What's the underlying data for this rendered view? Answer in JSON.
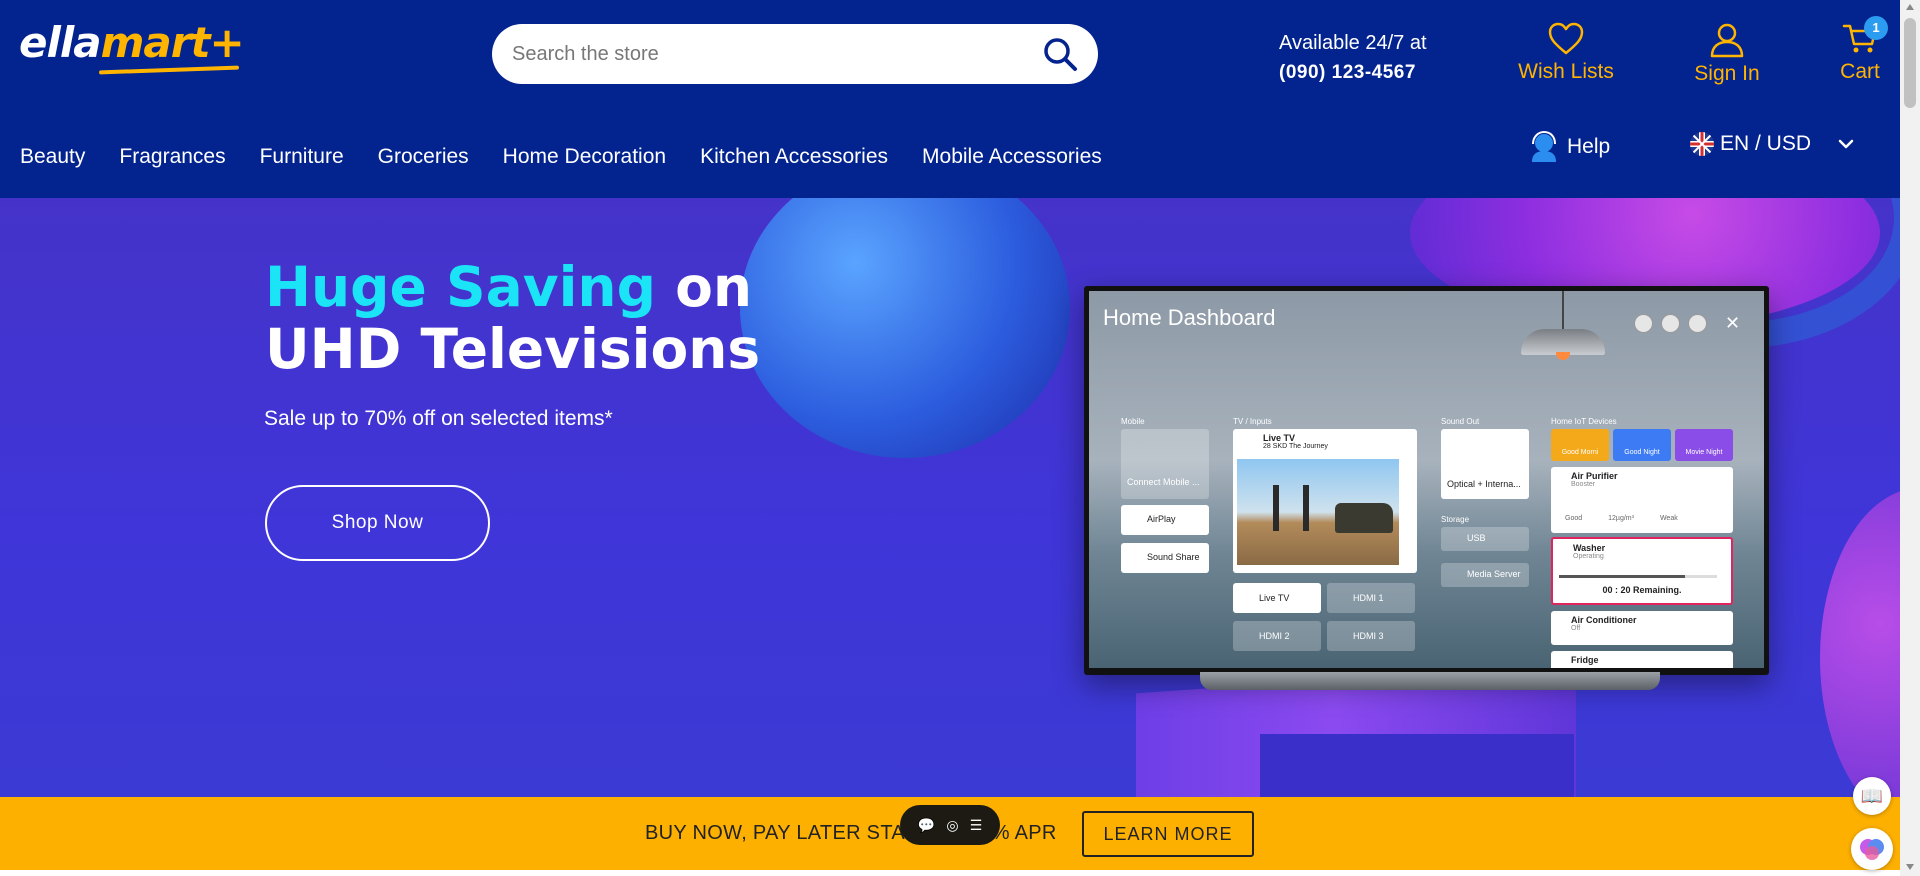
{
  "brand": {
    "logo_part1": "ella",
    "logo_part2": "mart+"
  },
  "search": {
    "placeholder": "Search the store"
  },
  "contact": {
    "label": "Available 24/7 at",
    "phone": "(090) 123-4567"
  },
  "header_actions": {
    "wishlist_label": "Wish Lists",
    "signin_label": "Sign In",
    "cart_label": "Cart",
    "cart_count": "1"
  },
  "nav": {
    "items": [
      {
        "label": "Beauty"
      },
      {
        "label": "Fragrances"
      },
      {
        "label": "Furniture"
      },
      {
        "label": "Groceries"
      },
      {
        "label": "Home Decoration"
      },
      {
        "label": "Kitchen Accessories"
      },
      {
        "label": "Mobile Accessories"
      }
    ],
    "help_label": "Help",
    "locale_label": "EN / USD"
  },
  "hero": {
    "title_highlight": "Huge Saving",
    "title_rest1": " on",
    "title_line2": "UHD Televisions",
    "subtitle": "Sale up to 70% off on selected items*",
    "cta_label": "Shop Now"
  },
  "tv_ui": {
    "title": "Home Dashboard",
    "sections": {
      "mobile": "Mobile",
      "tv_inputs": "TV / Inputs",
      "sound_out": "Sound Out",
      "storage": "Storage",
      "home_iot": "Home IoT Devices"
    },
    "mobile_cards": [
      "Connect Mobile ...",
      "AirPlay",
      "Sound Share"
    ],
    "live_tv": {
      "title": "Live TV",
      "channel": "28 SKD The Journey"
    },
    "inputs": [
      "Live TV",
      "HDMI 1",
      "HDMI 2",
      "HDMI 3"
    ],
    "sound_out_label": "Optical + Interna...",
    "storage_items": [
      "USB",
      "Media Server"
    ],
    "iot_tiles": [
      "Good Morni",
      "Good Night",
      "Movie Night"
    ],
    "devices": {
      "air_purifier": {
        "name": "Air Purifier",
        "status": "Booster",
        "stats": [
          "Good",
          "12µg/m³",
          "Weak"
        ]
      },
      "washer": {
        "name": "Washer",
        "status": "Operating",
        "remaining": "00 : 20 Remaining.",
        "progress": 0.8
      },
      "air_conditioner": {
        "name": "Air Conditioner",
        "status": "Off"
      },
      "fridge": {
        "name": "Fridge"
      }
    }
  },
  "promo": {
    "text": "BUY NOW, PAY LATER STAR",
    "text_tail": "% APR",
    "cta_label": "LEARN MORE"
  },
  "colors": {
    "header_bg": "#03238f",
    "accent": "#ffb400",
    "hero_highlight": "#1ae4f5",
    "promo_bg": "#fdb000",
    "badge": "#2c9cf0"
  }
}
